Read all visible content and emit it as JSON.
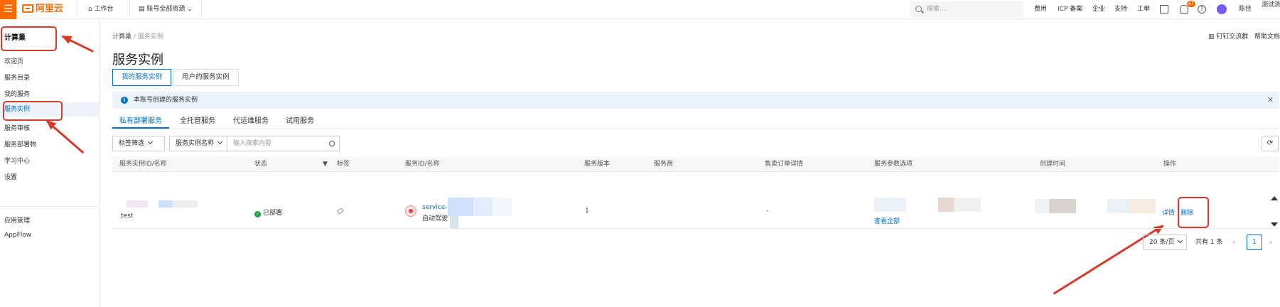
{
  "topbar": {
    "logo_text": "阿里云",
    "workbench": "工作台",
    "account_resources": "账号全部资源",
    "search_placeholder": "搜索...",
    "links": [
      "费用",
      "ICP 备案",
      "企业",
      "支持",
      "工单"
    ],
    "notification_count": "67",
    "user_short": "陈佳",
    "account_name": "测试测"
  },
  "sidebar": {
    "title": "计算巢",
    "items": [
      "欢迎页",
      "服务目录",
      "我的服务",
      "服务实例",
      "服务审核",
      "服务部署物",
      "学习中心",
      "设置"
    ],
    "bottom_items": [
      "应用管理",
      "AppFlow"
    ],
    "active_index": 3
  },
  "breadcrumb": {
    "root": "计算巢",
    "sep": "/",
    "current": "服务实例"
  },
  "header_links": {
    "dingtalk": "钉钉交流群",
    "help": "帮助文档"
  },
  "page": {
    "title": "服务实例",
    "tabs": [
      "我的服务实例",
      "用户的服务实例"
    ],
    "info_text": "本账号创建的服务实例",
    "subtabs": [
      "私有部署服务",
      "全托管服务",
      "代运维服务",
      "试用服务"
    ],
    "filter": {
      "tag_filter": "标签筛选",
      "field_select": "服务实例名称",
      "search_placeholder": "输入搜索内容"
    }
  },
  "table": {
    "columns": [
      "服务实例ID/名称",
      "状态",
      "标签",
      "服务ID/名称",
      "服务版本",
      "服务商",
      "售卖订单详情",
      "服务参数选项",
      "创建时间",
      "操作"
    ],
    "rows": [
      {
        "instance_name": "test",
        "status": "已部署",
        "service_id": "service-1e",
        "service_name": "自动驾驶",
        "version": "1",
        "order_detail": "-",
        "params_link": "查看全部",
        "action_detail": "详情",
        "action_delete": "删除"
      }
    ]
  },
  "pager": {
    "page_size": "20 条/页",
    "total": "共有 1 条",
    "current_page": "1"
  },
  "colors": {
    "brand": "#ff6a00",
    "link": "#0070cc",
    "annotation": "#d63a2a",
    "success": "#1e9e44"
  }
}
